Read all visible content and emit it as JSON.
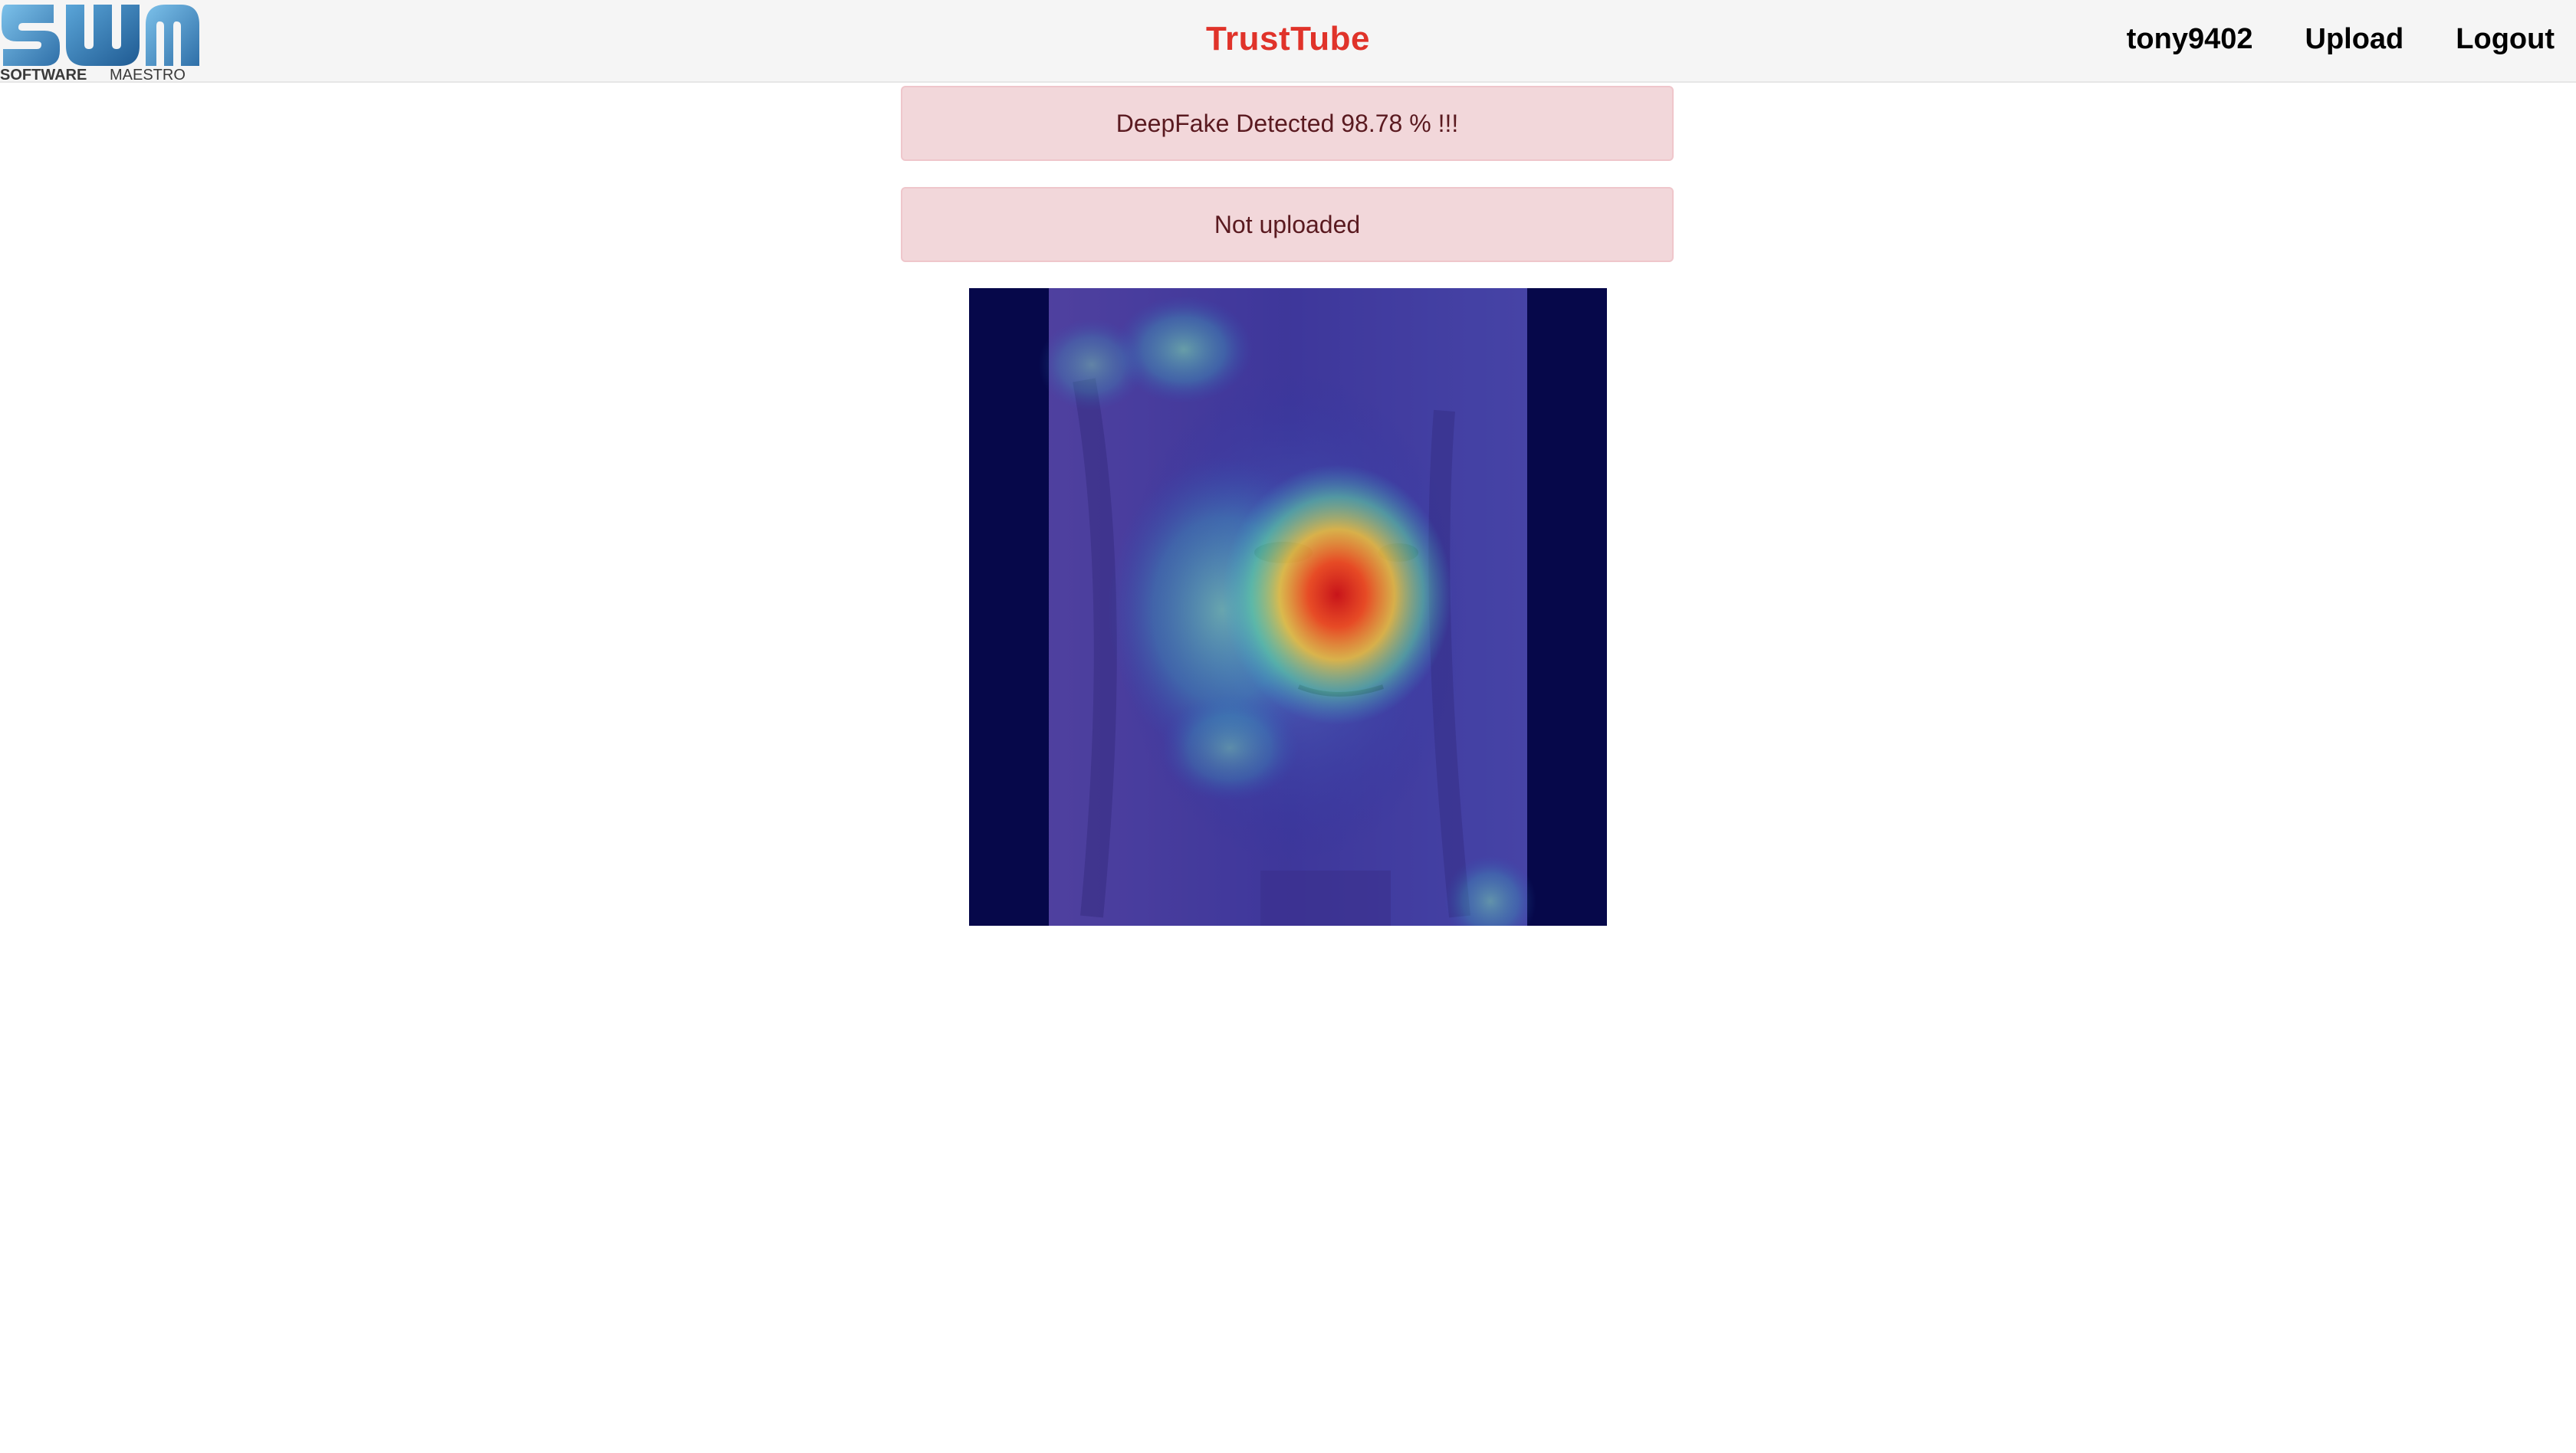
{
  "header": {
    "logo": {
      "alt": "SOFTWARE MAESTRO",
      "brand_colors": [
        "#2f6fa8",
        "#5aa5d8"
      ],
      "word_software": "SOFTWARE",
      "word_maestro": "MAESTRO"
    },
    "title": "TrustTube",
    "title_color": "#e0332a",
    "nav": {
      "username": "tony9402",
      "upload_label": "Upload",
      "logout_label": "Logout"
    }
  },
  "alerts": [
    {
      "text": "DeepFake Detected 98.78 % !!!"
    },
    {
      "text": "Not uploaded"
    }
  ],
  "result_image": {
    "alt": "DeepFake heatmap overlay of face",
    "colors": {
      "background": "#060a4c",
      "hot": "#e2221b",
      "warm": "#f3d23a",
      "cool": "#46c6b0"
    }
  }
}
